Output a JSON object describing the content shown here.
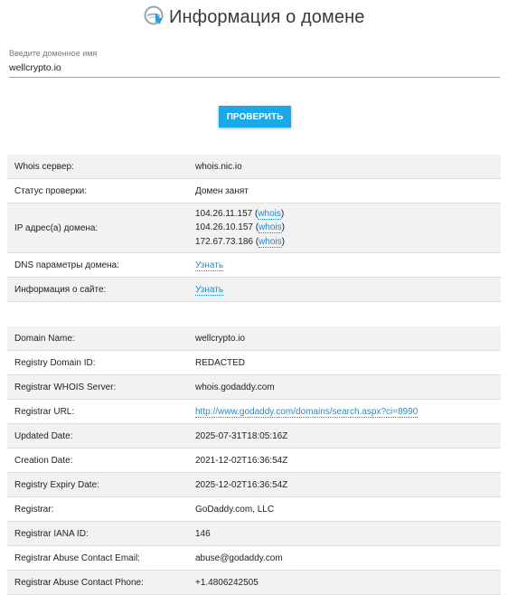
{
  "header": {
    "title": "Информация о домене"
  },
  "search": {
    "label": "Введите доменное имя",
    "value": "wellcrypto.io",
    "placeholder": ""
  },
  "check_button": {
    "label": "ПРОВЕРИТЬ"
  },
  "summary": {
    "whois_server": {
      "key": "Whois сервер:",
      "value": "whois.nic.io"
    },
    "status": {
      "key": "Статус проверки:",
      "value": "Домен занят"
    },
    "ip": {
      "key": "IP адрес(а) домена:",
      "addresses": [
        {
          "ip": "104.26.11.157",
          "link": "whois"
        },
        {
          "ip": "104.26.10.157",
          "link": "whois"
        },
        {
          "ip": "172.67.73.186",
          "link": "whois"
        }
      ]
    },
    "dns": {
      "key": "DNS параметры домена:",
      "link": "Узнать"
    },
    "site_info": {
      "key": "Информация о сайте:",
      "link": "Узнать"
    }
  },
  "whois": [
    {
      "key": "Domain Name:",
      "value": "wellcrypto.io"
    },
    {
      "key": "Registry Domain ID:",
      "value": "REDACTED"
    },
    {
      "key": "Registrar WHOIS Server:",
      "value": "whois.godaddy.com"
    },
    {
      "key": "Registrar URL:",
      "value": "http://www.godaddy.com/domains/search.aspx?ci=8990"
    },
    {
      "key": "Updated Date:",
      "value": "2025-07-31T18:05:16Z"
    },
    {
      "key": "Creation Date:",
      "value": "2021-12-02T16:36:54Z"
    },
    {
      "key": "Registry Expiry Date:",
      "value": "2025-12-02T16:36:54Z"
    },
    {
      "key": "Registrar:",
      "value": "GoDaddy.com, LLC"
    },
    {
      "key": "Registrar IANA ID:",
      "value": "146"
    },
    {
      "key": "Registrar Abuse Contact Email:",
      "value": "abuse@godaddy.com"
    },
    {
      "key": "Registrar Abuse Contact Phone:",
      "value": "+1.4806242505"
    }
  ]
}
